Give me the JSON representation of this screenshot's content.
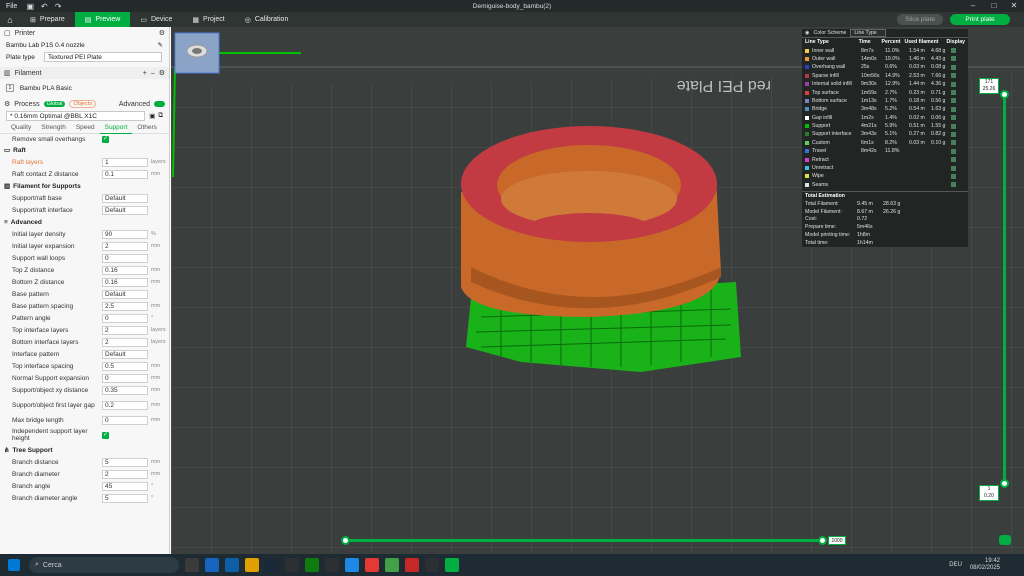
{
  "window": {
    "title": "Demiguise-body_bambu(2)",
    "file_menu": "File"
  },
  "nav": {
    "tabs": [
      "Prepare",
      "Preview",
      "Device",
      "Project",
      "Calibration"
    ],
    "active": "Preview",
    "slice_label": "Slice plate",
    "print_label": "Print plate"
  },
  "printer": {
    "section": "Printer",
    "name": "Bambu Lab P1S 0.4 nozzle",
    "plate_type_label": "Plate type",
    "plate_type": "Textured PEI Plate"
  },
  "filament": {
    "section": "Filament",
    "item_index": "1",
    "name": "Bambu PLA Basic"
  },
  "process": {
    "section": "Process",
    "global_label": "Global",
    "objects_label": "Objects",
    "advanced_label": "Advanced",
    "preset": "* 0.16mm Optimal @BBL X1C",
    "tabs": [
      "Quality",
      "Strength",
      "Speed",
      "Support",
      "Others"
    ],
    "active_tab": "Support"
  },
  "settings": {
    "remove_small_overhangs": "Remove small overhangs",
    "raft_group": "Raft",
    "raft_layers": {
      "label": "Raft layers",
      "value": "1",
      "unit": "layers"
    },
    "raft_contact_z": {
      "label": "Raft contact Z distance",
      "value": "0.1",
      "unit": "mm"
    },
    "filament_supports_group": "Filament for Supports",
    "support_raft_base": {
      "label": "Support/raft base",
      "value": "Default"
    },
    "support_raft_interface": {
      "label": "Support/raft interface",
      "value": "Default"
    },
    "advanced_group": "Advanced",
    "rows": [
      {
        "label": "Initial layer density",
        "value": "90",
        "unit": "%"
      },
      {
        "label": "Initial layer expansion",
        "value": "2",
        "unit": "mm"
      },
      {
        "label": "Support wall loops",
        "value": "0",
        "unit": ""
      },
      {
        "label": "Top Z distance",
        "value": "0.16",
        "unit": "mm"
      },
      {
        "label": "Bottom Z distance",
        "value": "0.16",
        "unit": "mm"
      },
      {
        "label": "Base pattern",
        "value": "Default",
        "unit": ""
      },
      {
        "label": "Base pattern spacing",
        "value": "2.5",
        "unit": "mm"
      },
      {
        "label": "Pattern angle",
        "value": "0",
        "unit": "°"
      },
      {
        "label": "Top interface layers",
        "value": "2",
        "unit": "layers"
      },
      {
        "label": "Bottom interface layers",
        "value": "2",
        "unit": "layers"
      },
      {
        "label": "Interface pattern",
        "value": "Default",
        "unit": ""
      },
      {
        "label": "Top interface spacing",
        "value": "0.5",
        "unit": "mm"
      },
      {
        "label": "Normal Support expansion",
        "value": "0",
        "unit": "mm"
      },
      {
        "label": "Support/object xy distance",
        "value": "0.35",
        "unit": "mm"
      },
      {
        "label": "Support/object first layer gap",
        "value": "0.2",
        "unit": "mm"
      },
      {
        "label": "Max bridge length",
        "value": "0",
        "unit": "mm"
      },
      {
        "label": "Independent support layer height",
        "value": "",
        "unit": ""
      }
    ],
    "tree_group": "Tree Support",
    "tree_rows": [
      {
        "label": "Branch distance",
        "value": "5",
        "unit": "mm"
      },
      {
        "label": "Branch diameter",
        "value": "2",
        "unit": "mm"
      },
      {
        "label": "Branch angle",
        "value": "45",
        "unit": "°"
      },
      {
        "label": "Branch diameter angle",
        "value": "5",
        "unit": "°"
      }
    ]
  },
  "legend": {
    "title": "Color Scheme",
    "scheme": "Line Type",
    "headers": [
      "Line Type",
      "Time",
      "Percent",
      "Used filament",
      "Display"
    ],
    "rows": [
      {
        "name": "Inner wall",
        "time": "8m7s",
        "pct": "11.0%",
        "len": "1.54 m",
        "wt": "4.68 g",
        "color": "#f6cc46"
      },
      {
        "name": "Outer wall",
        "time": "14m0s",
        "pct": "19.0%",
        "len": "1.46 m",
        "wt": "4.43 g",
        "color": "#f39a2e"
      },
      {
        "name": "Overhang wall",
        "time": "25s",
        "pct": "0.6%",
        "len": "0.03 m",
        "wt": "0.08 g",
        "color": "#2541c8"
      },
      {
        "name": "Sparse infill",
        "time": "10m56s",
        "pct": "14.9%",
        "len": "2.53 m",
        "wt": "7.66 g",
        "color": "#b33a3a"
      },
      {
        "name": "Internal solid infill",
        "time": "9m30s",
        "pct": "12.9%",
        "len": "1.44 m",
        "wt": "4.36 g",
        "color": "#9a3fb0"
      },
      {
        "name": "Top surface",
        "time": "1m59s",
        "pct": "2.7%",
        "len": "0.23 m",
        "wt": "0.71 g",
        "color": "#e53a3a"
      },
      {
        "name": "Bottom surface",
        "time": "1m13s",
        "pct": "1.7%",
        "len": "0.18 m",
        "wt": "0.56 g",
        "color": "#7286c8"
      },
      {
        "name": "Bridge",
        "time": "3m48s",
        "pct": "5.2%",
        "len": "0.54 m",
        "wt": "1.63 g",
        "color": "#4f8fbf"
      },
      {
        "name": "Gap infill",
        "time": "1m2s",
        "pct": "1.4%",
        "len": "0.02 m",
        "wt": "0.06 g",
        "color": "#ffffff"
      },
      {
        "name": "Support",
        "time": "4m21s",
        "pct": "5.9%",
        "len": "0.51 m",
        "wt": "1.55 g",
        "color": "#00c000"
      },
      {
        "name": "Support interface",
        "time": "3m43s",
        "pct": "5.1%",
        "len": "0.27 m",
        "wt": "0.82 g",
        "color": "#2a7f2a"
      },
      {
        "name": "Custom",
        "time": "6m1s",
        "pct": "8.2%",
        "len": "0.03 m",
        "wt": "0.10 g",
        "color": "#5fd05f"
      },
      {
        "name": "Travel",
        "time": "8m42s",
        "pct": "11.8%",
        "len": "",
        "wt": "",
        "color": "#3b6fd8"
      },
      {
        "name": "Retract",
        "time": "",
        "pct": "",
        "len": "",
        "wt": "",
        "color": "#d040d0"
      },
      {
        "name": "Unretract",
        "time": "",
        "pct": "",
        "len": "",
        "wt": "",
        "color": "#40c0e0"
      },
      {
        "name": "Wipe",
        "time": "",
        "pct": "",
        "len": "",
        "wt": "",
        "color": "#e0e040"
      },
      {
        "name": "Seams",
        "time": "",
        "pct": "",
        "len": "",
        "wt": "",
        "color": "#e0e0e0"
      }
    ],
    "estimation_title": "Total Estimation",
    "estimation": [
      {
        "k": "Total Filament:",
        "v1": "9.45 m",
        "v2": "28.63 g"
      },
      {
        "k": "Model Filament:",
        "v1": "8.67 m",
        "v2": "26.26 g"
      },
      {
        "k": "Cost:",
        "v1": "0.72",
        "v2": ""
      },
      {
        "k": "Prepare time:",
        "v1": "5m46s",
        "v2": ""
      },
      {
        "k": "Model printing time:",
        "v1": "1h8m",
        "v2": ""
      },
      {
        "k": "Total time:",
        "v1": "1h14m",
        "v2": ""
      }
    ]
  },
  "sliders": {
    "layer_top_label": "171",
    "layer_top_height": "25.26",
    "layer_bottom_label": "1",
    "layer_bottom_height": "0.20",
    "move_value": "1000"
  },
  "plate_text": "red PEI Plate",
  "taskbar": {
    "search": "Cerca",
    "temp": "",
    "lang": "DEU",
    "time": "19:42",
    "date": "08/02/2025"
  },
  "colors": {
    "accent": "#00ae42"
  }
}
